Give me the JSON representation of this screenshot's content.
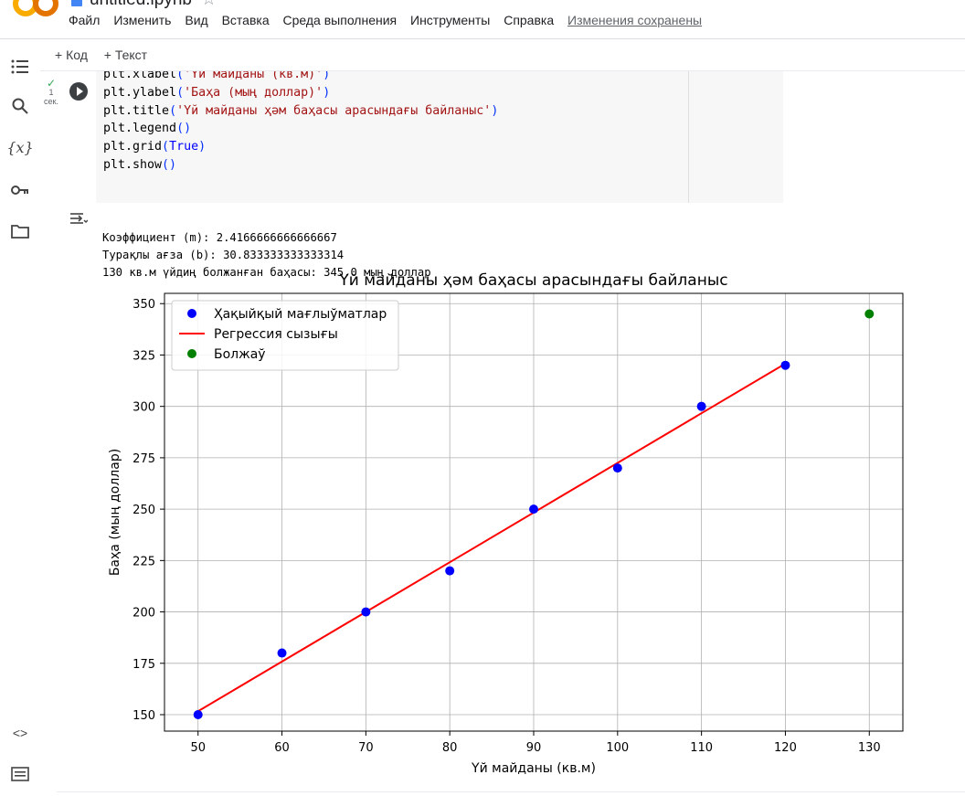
{
  "app": {
    "doc_title": "untitled.ipynb",
    "menu": [
      "Файл",
      "Изменить",
      "Вид",
      "Вставка",
      "Среда выполнения",
      "Инструменты",
      "Справка"
    ],
    "saved_status": "Изменения сохранены"
  },
  "toolbar": {
    "code_button": "+ Код",
    "text_button": "+ Текст"
  },
  "cell": {
    "status_seconds": "1",
    "status_unit": "сек.",
    "code_lines": [
      "plt.xlabel('Үй майданы (кв.м)')",
      "plt.ylabel('Баҳа (мың доллар)')",
      "plt.title('Үй майданы ҳәм баҳасы арасындағы байланыс')",
      "plt.legend()",
      "plt.grid(True)",
      "plt.show()"
    ],
    "output_lines": [
      "Коэффициент (m): 2.4166666666666667",
      "Турақлы ағза (b): 30.833333333333314",
      "130 кв.м үйдиң болжанған баҳасы: 345.0 мың доллар"
    ]
  },
  "colors": {
    "actual": "#0000ff",
    "line": "#ff0000",
    "predict": "#008000",
    "accent": "#f9ab00"
  },
  "chart_data": {
    "type": "scatter",
    "title": "Үй майданы ҳәм баҳасы арасындағы байланыс",
    "xlabel": "Үй майданы (кв.м)",
    "ylabel": "Баҳа (мың доллар)",
    "xlim": [
      46,
      134
    ],
    "ylim": [
      142,
      355
    ],
    "xticks": [
      50,
      60,
      70,
      80,
      90,
      100,
      110,
      120,
      130
    ],
    "yticks": [
      150,
      175,
      200,
      225,
      250,
      275,
      300,
      325,
      350
    ],
    "grid": true,
    "legend_position": "top-left",
    "series": [
      {
        "name": "Ҳақыйқый мағлыўматлар",
        "kind": "scatter",
        "color": "#0000ff",
        "x": [
          50,
          60,
          70,
          80,
          90,
          100,
          110,
          120
        ],
        "y": [
          150,
          180,
          200,
          220,
          250,
          270,
          300,
          320
        ]
      },
      {
        "name": "Регрессия сызығы",
        "kind": "line",
        "color": "#ff0000",
        "x": [
          50,
          120
        ],
        "y": [
          151.67,
          320.83
        ]
      },
      {
        "name": "Болжаў",
        "kind": "scatter",
        "color": "#008000",
        "x": [
          130
        ],
        "y": [
          345
        ]
      }
    ]
  }
}
